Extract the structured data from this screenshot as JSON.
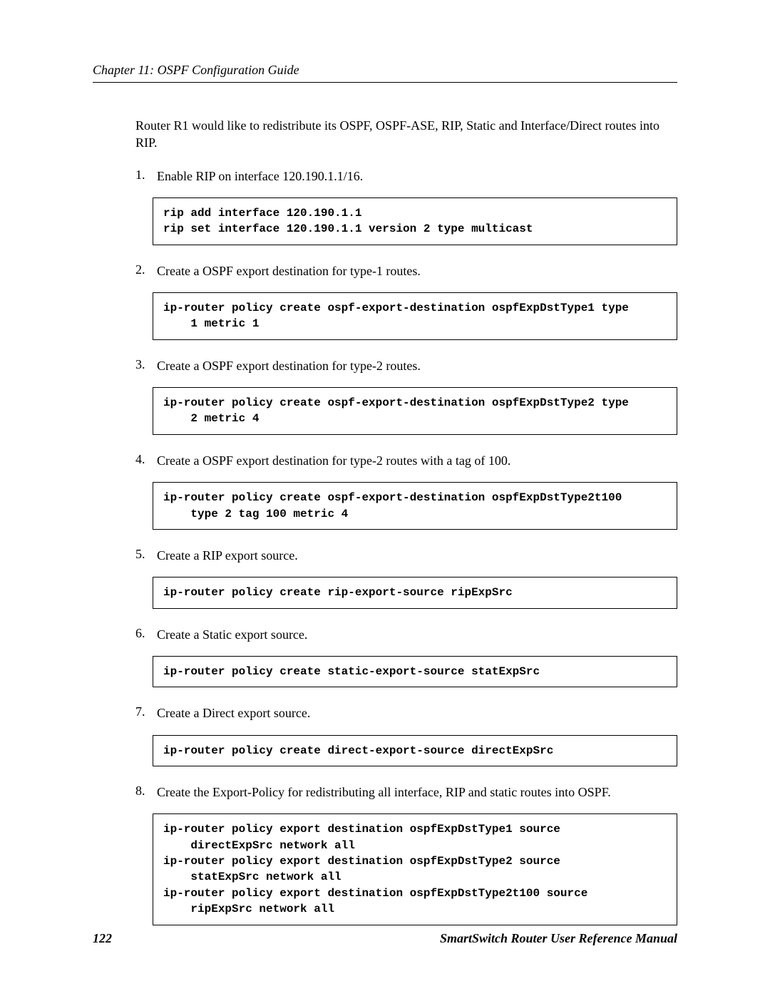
{
  "header": {
    "chapterLabel": "Chapter 11: OSPF Configuration Guide"
  },
  "intro": "Router R1 would like to redistribute its OSPF, OSPF-ASE, RIP, Static and Interface/Direct routes into RIP.",
  "steps": [
    {
      "text": "Enable RIP on interface 120.190.1.1/16.",
      "code": "rip add interface 120.190.1.1\nrip set interface 120.190.1.1 version 2 type multicast"
    },
    {
      "text": "Create a OSPF export destination for type-1 routes.",
      "code": "ip-router policy create ospf-export-destination ospfExpDstType1 type \n    1 metric 1"
    },
    {
      "text": "Create a OSPF export destination for type-2 routes.",
      "code": "ip-router policy create ospf-export-destination ospfExpDstType2 type \n    2 metric 4"
    },
    {
      "text": "Create a OSPF export destination for type-2 routes with a tag of 100.",
      "code": "ip-router policy create ospf-export-destination ospfExpDstType2t100 \n    type 2 tag 100 metric 4"
    },
    {
      "text": "Create a RIP export source.",
      "code": "ip-router policy create rip-export-source ripExpSrc"
    },
    {
      "text": "Create a Static export source.",
      "code": "ip-router policy create static-export-source statExpSrc"
    },
    {
      "text": "Create a Direct export source.",
      "code": "ip-router policy create direct-export-source directExpSrc"
    },
    {
      "text": "Create the Export-Policy for redistributing all interface, RIP and static routes into OSPF.",
      "code": "ip-router policy export destination ospfExpDstType1 source \n    directExpSrc network all\nip-router policy export destination ospfExpDstType2 source \n    statExpSrc network all\nip-router policy export destination ospfExpDstType2t100 source \n    ripExpSrc network all"
    }
  ],
  "footer": {
    "pageNumber": "122",
    "manualTitle": "SmartSwitch Router User Reference Manual"
  }
}
